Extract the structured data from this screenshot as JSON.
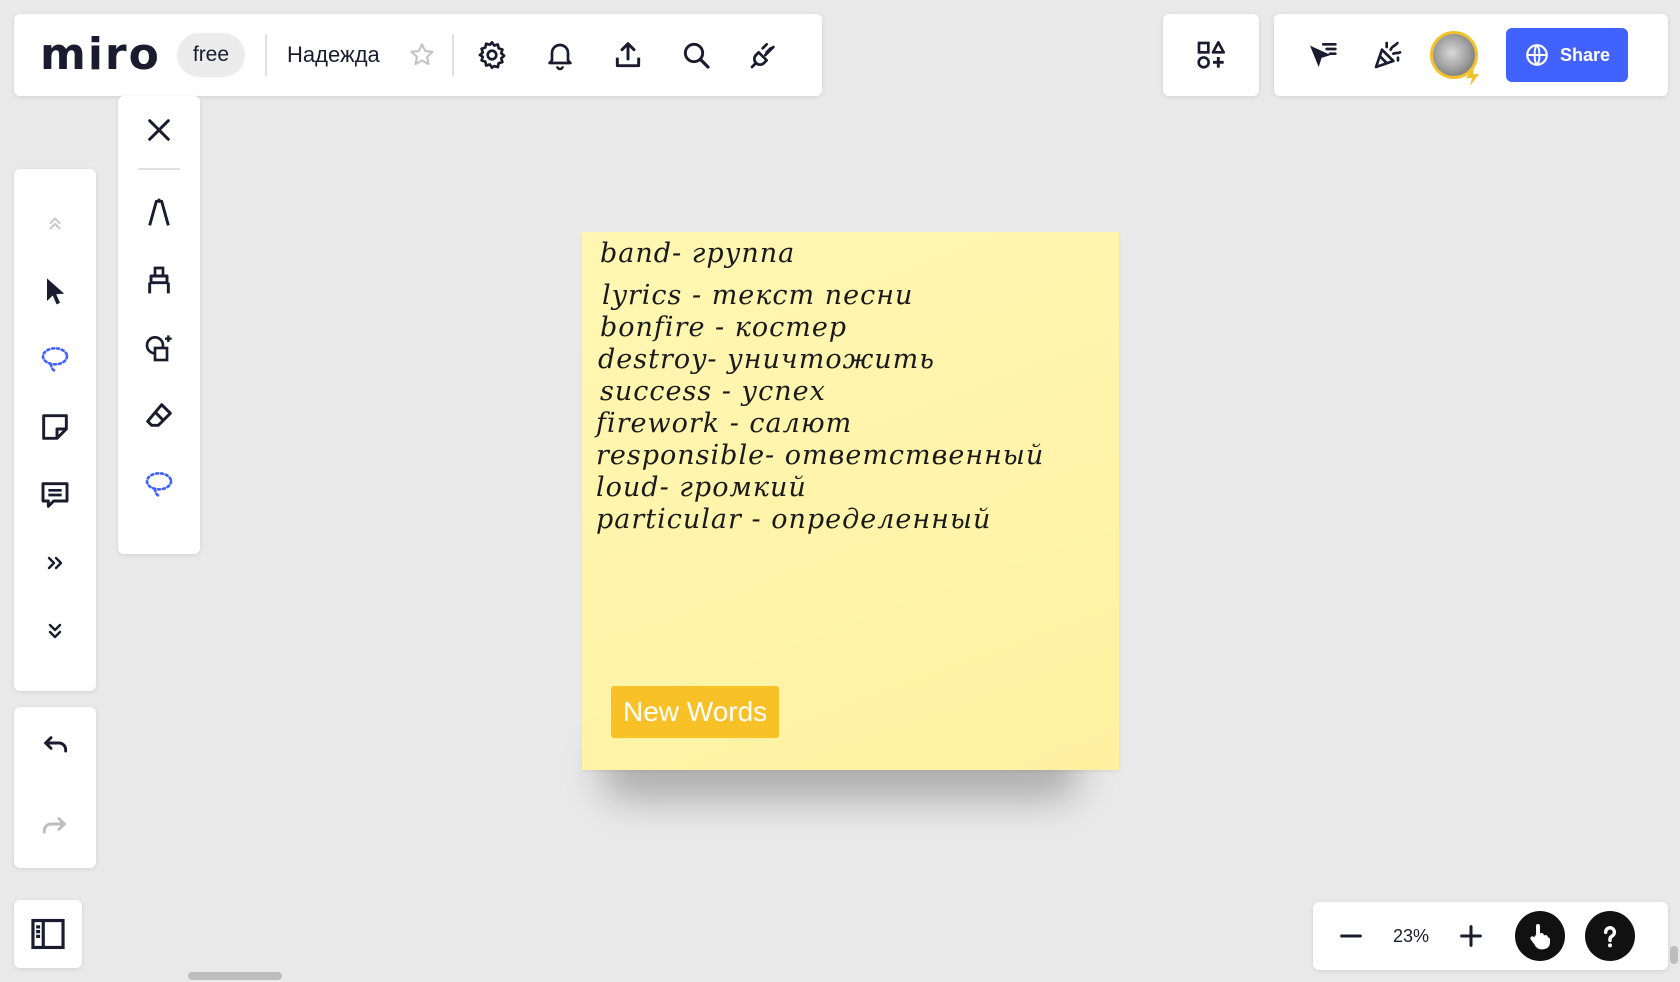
{
  "header": {
    "logo_text": "miro",
    "plan_badge": "free",
    "board_name": "Надежда"
  },
  "share": {
    "label": "Share"
  },
  "sticky_note": {
    "lines": [
      "band- группа",
      "lyrics - текст песни",
      "bonfire - костер",
      "destroy- уничтожить",
      "success - успех",
      "firework - салют",
      "responsible- ответственный",
      "loud- громкий",
      "particular - определенный"
    ],
    "tag": "New Words",
    "color": "#fff4a8",
    "tag_color": "#f7c127"
  },
  "zoom": {
    "value": "23%"
  },
  "colors": {
    "accent": "#4262ff",
    "canvas": "#e9e9e9",
    "ink": "#1b1b2f",
    "lasso": "#4262ff"
  },
  "icons": {
    "top_toolbar": [
      "star-icon",
      "settings-icon",
      "bell-icon",
      "export-icon",
      "search-icon",
      "plugin-icon"
    ],
    "left_tools": [
      "chevrons-up-icon",
      "cursor-icon",
      "lasso-icon",
      "sticky-note-icon",
      "comment-icon",
      "chevrons-right-icon",
      "chevrons-down-icon"
    ],
    "pen_tools": [
      "close-icon",
      "pen-icon",
      "highlighter-icon",
      "smart-shape-icon",
      "eraser-icon",
      "lasso-icon"
    ]
  }
}
